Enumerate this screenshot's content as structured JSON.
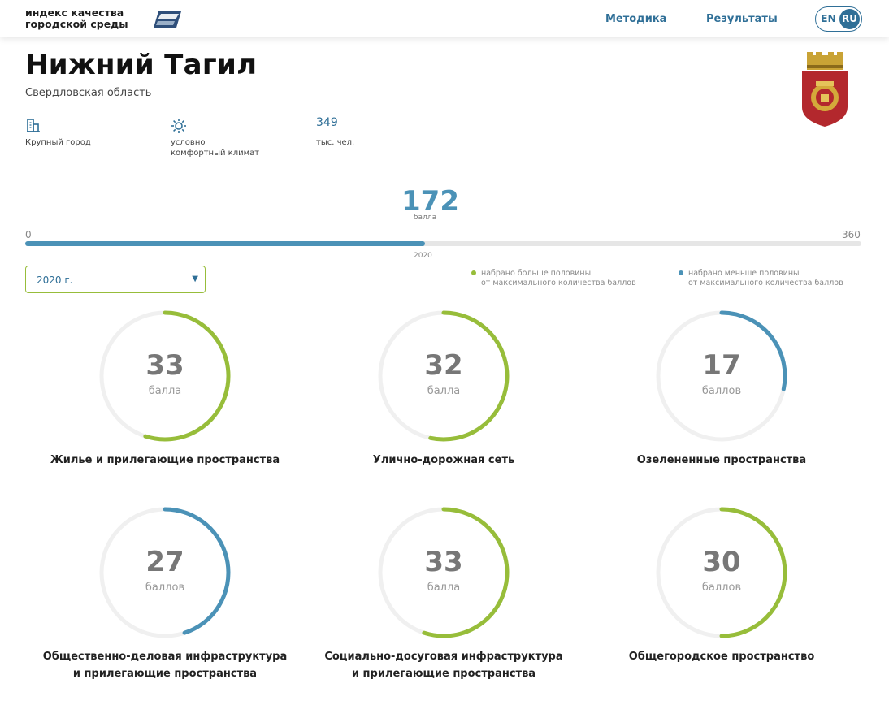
{
  "header": {
    "logo_line1": "индекс качества",
    "logo_line2": "городской среды",
    "nav": [
      "Методика",
      "Результаты"
    ],
    "lang_en": "EN",
    "lang_ru": "RU"
  },
  "city": {
    "name": "Нижний Тагил",
    "region": "Свердловская область",
    "features": [
      {
        "icon": "buildings-icon",
        "label": "Крупный город"
      },
      {
        "icon": "sun-icon",
        "label": "условно комфортный климат"
      },
      {
        "value": "349",
        "label": "тыс. чел."
      }
    ]
  },
  "total": {
    "value": "172",
    "unit": "балла",
    "min": "0",
    "max": "360",
    "year": "2020",
    "fraction": 0.478
  },
  "year_select": {
    "value": "2020 г."
  },
  "legend": [
    {
      "color": "#97bd3a",
      "line1": "набрано больше половины",
      "line2": "от максимального количества баллов"
    },
    {
      "color": "#4b92b7",
      "line1": "набрано меньше половины",
      "line2": "от максимального количества баллов"
    }
  ],
  "colors": {
    "above_half": "#97bd3a",
    "below_half": "#4b92b7",
    "accent": "#2f6f97"
  },
  "chart_data": {
    "type": "gauge",
    "max_per_category": 60,
    "categories": [
      {
        "name": "Жилье и прилегающие пространства",
        "value": 33,
        "unit": "балла"
      },
      {
        "name": "Улично-дорожная сеть",
        "value": 32,
        "unit": "балла"
      },
      {
        "name": "Озелененные пространства",
        "value": 17,
        "unit": "баллов"
      },
      {
        "name_line1": "Общественно-деловая инфраструктура",
        "name_line2": "и прилегающие пространства",
        "value": 27,
        "unit": "баллов"
      },
      {
        "name_line1": "Социально-досуговая инфраструктура",
        "name_line2": "и прилегающие пространства",
        "value": 33,
        "unit": "балла"
      },
      {
        "name": "Общегородское пространство",
        "value": 30,
        "unit": "баллов"
      }
    ]
  }
}
